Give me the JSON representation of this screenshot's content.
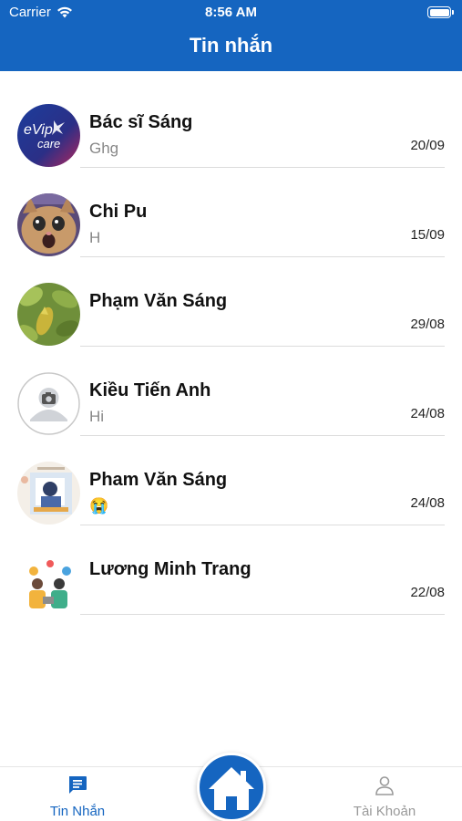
{
  "status_bar": {
    "carrier": "Carrier",
    "time": "8:56 AM"
  },
  "header": {
    "title": "Tin nhắn"
  },
  "chats": [
    {
      "name": "Bác sĩ Sáng",
      "preview": "Ghg",
      "date": "20/09",
      "avatar": "evip-care-logo"
    },
    {
      "name": "Chi Pu",
      "preview": "H",
      "date": "15/09",
      "avatar": "cat-photo"
    },
    {
      "name": "Phạm Văn Sáng",
      "preview": "",
      "date": "29/08",
      "avatar": "leaves-photo"
    },
    {
      "name": "Kiều Tiến Anh",
      "preview": "Hi",
      "date": "24/08",
      "avatar": "default-avatar"
    },
    {
      "name": "Pham Văn Sáng",
      "preview": "😭",
      "date": "24/08",
      "avatar": "illustration"
    },
    {
      "name": "Lương Minh Trang",
      "preview": "",
      "date": "22/08",
      "avatar": "people-illustration"
    }
  ],
  "tabs": {
    "messages": "Tin Nhắn",
    "account": "Tài Khoản"
  },
  "colors": {
    "primary": "#1565C0",
    "inactive": "#999999"
  },
  "avatar_labels": {
    "evip": "eVip",
    "care": "care"
  }
}
